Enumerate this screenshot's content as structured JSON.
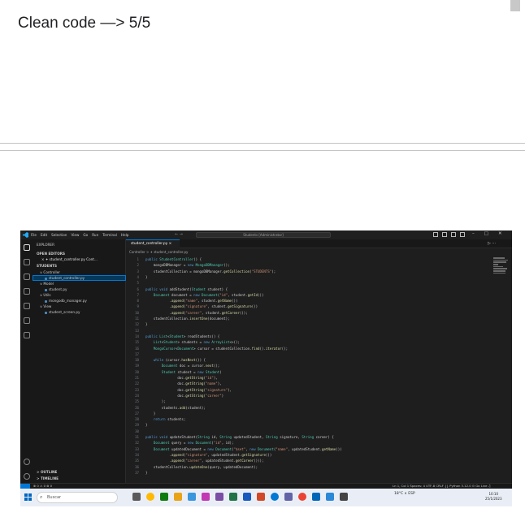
{
  "heading": "Clean code —> 5/5",
  "vscode": {
    "menu": [
      "File",
      "Edit",
      "Selection",
      "View",
      "Go",
      "Run",
      "Terminal",
      "Help"
    ],
    "search": "Students [Administrator]",
    "sidebar": {
      "explorer_label": "EXPLORER",
      "open_editors_label": "OPEN EDITORS",
      "open_editor_file": "× ✦ student_controller.py  Cont...",
      "project_label": "STUDENTS",
      "tree": [
        {
          "label": "∨ Controller",
          "indent": 0
        },
        {
          "label": "student_controller.py",
          "indent": 1,
          "selected": true
        },
        {
          "label": "∨ Model",
          "indent": 0
        },
        {
          "label": "student.py",
          "indent": 1
        },
        {
          "label": "∨ Utils",
          "indent": 0
        },
        {
          "label": "mongodb_manager.py",
          "indent": 1
        },
        {
          "label": "∨ View",
          "indent": 0
        },
        {
          "label": "student_screen.py",
          "indent": 1
        }
      ],
      "outline_label": "> OUTLINE",
      "timeline_label": "> TIMELINE"
    },
    "tab_label": "student_controller.py ×",
    "breadcrumb": "Controller > ✦ student_controller.py",
    "code_lines": [
      [
        "1",
        "public StudentController() {"
      ],
      [
        "2",
        "    mongoDBManager = new MongoDBManager();"
      ],
      [
        "3",
        "    studentCollection = mongoDBManager.getCollection(\"STUDENTS\");"
      ],
      [
        "4",
        "}"
      ],
      [
        "5",
        ""
      ],
      [
        "6",
        "public void addStudent(Student student) {"
      ],
      [
        "7",
        "    Document document = new Document(\"id\", student.getId())"
      ],
      [
        "8",
        "            .append(\"name\", student.getName())"
      ],
      [
        "9",
        "            .append(\"signature\", student.getSignature())"
      ],
      [
        "10",
        "            .append(\"career\", student.getCareer());"
      ],
      [
        "11",
        "    studentCollection.insertOne(document);"
      ],
      [
        "12",
        "}"
      ],
      [
        "13",
        ""
      ],
      [
        "14",
        "public List<Student> readStudents() {"
      ],
      [
        "15",
        "    List<Student> students = new ArrayList<>();"
      ],
      [
        "16",
        "    MongoCursor<Document> cursor = studentCollection.find().iterator();"
      ],
      [
        "17",
        ""
      ],
      [
        "18",
        "    while (cursor.hasNext()) {"
      ],
      [
        "19",
        "        Document doc = cursor.next();"
      ],
      [
        "20",
        "        Student student = new Student("
      ],
      [
        "21",
        "                doc.getString(\"id\"),"
      ],
      [
        "22",
        "                doc.getString(\"name\"),"
      ],
      [
        "23",
        "                doc.getString(\"signature\"),"
      ],
      [
        "24",
        "                doc.getString(\"career\")"
      ],
      [
        "25",
        "        );"
      ],
      [
        "26",
        "        students.add(student);"
      ],
      [
        "27",
        "    }"
      ],
      [
        "28",
        "    return students;"
      ],
      [
        "29",
        "}"
      ],
      [
        "30",
        ""
      ],
      [
        "31",
        "public void updateStudent(String id, String updatedStudent, String signature, String career) {"
      ],
      [
        "32",
        "    Document query = new Document(\"id\", id);"
      ],
      [
        "33",
        "    Document updatedDocument = new Document(\"$set\", new Document(\"name\", updatedStudent.getName())"
      ],
      [
        "34",
        "            .append(\"signature\", updatedStudent.getSignature())"
      ],
      [
        "35",
        "            .append(\"career\", updatedStudent.getCareer()));"
      ],
      [
        "36",
        "    studentCollection.updateOne(query, updatedDocument);"
      ],
      [
        "37",
        "}"
      ]
    ],
    "status_left": "⊗ 0 ⚠ 0   ⊗ 0",
    "status_right": "Ln 1, Col 1   Spaces: 4   UTF-8   CRLF   {} Python   3.12.0   ⊙ Go Live   ♫"
  },
  "taskbar": {
    "search_placeholder": "Buscar",
    "tray_text": "18°C  ∧  ESP",
    "clock_time": "10:10",
    "clock_date": "25/1/2023"
  },
  "colors": {
    "accent": "#0078d4",
    "editor_bg": "#1e1e1e",
    "sidebar_bg": "#181818"
  }
}
